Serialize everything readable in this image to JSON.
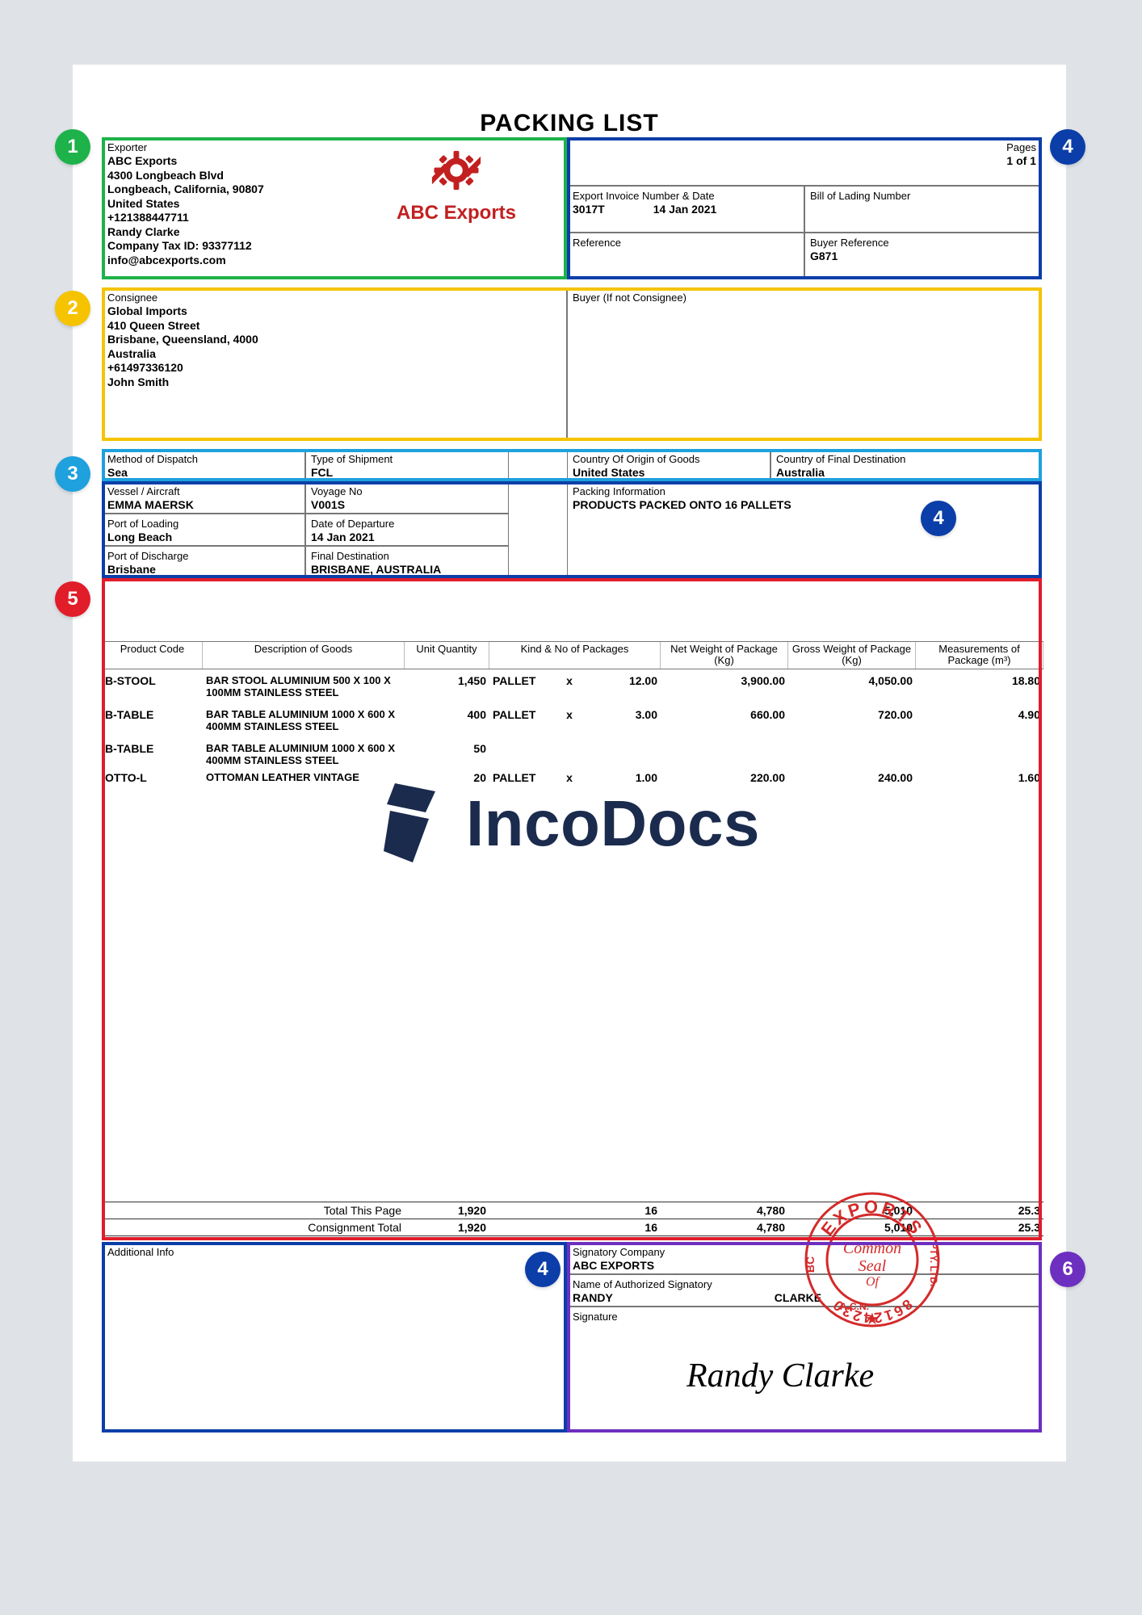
{
  "title": "PACKING LIST",
  "pages": {
    "label": "Pages",
    "value": "1 of 1"
  },
  "exporter": {
    "label": "Exporter",
    "name": "ABC Exports",
    "address1": "4300 Longbeach Blvd",
    "address2": "Longbeach, California, 90807",
    "country": "United States",
    "phone": "+121388447711",
    "contact": "Randy Clarke",
    "taxid": "Company Tax ID: 93377112",
    "email": "info@abcexports.com"
  },
  "logo_name": "ABC Exports",
  "invoice": {
    "label": "Export Invoice Number & Date",
    "number": "3017T",
    "date": "14 Jan 2021"
  },
  "bol": {
    "label": "Bill of Lading Number",
    "value": ""
  },
  "reference": {
    "label": "Reference",
    "value": ""
  },
  "buyer_ref": {
    "label": "Buyer Reference",
    "value": "G871"
  },
  "consignee": {
    "label": "Consignee",
    "name": "Global Imports",
    "address1": "410 Queen Street",
    "address2": "Brisbane, Queensland, 4000",
    "country": "Australia",
    "phone": "+61497336120",
    "contact": "John Smith"
  },
  "buyer_if_not": {
    "label": "Buyer (If not Consignee)",
    "value": ""
  },
  "dispatch": {
    "method": {
      "label": "Method of Dispatch",
      "value": "Sea"
    },
    "shipment_type": {
      "label": "Type of Shipment",
      "value": "FCL"
    },
    "origin": {
      "label": "Country Of Origin of Goods",
      "value": "United States"
    },
    "dest_country": {
      "label": "Country of Final Destination",
      "value": "Australia"
    },
    "vessel": {
      "label": "Vessel / Aircraft",
      "value": "EMMA MAERSK"
    },
    "voyage": {
      "label": "Voyage No",
      "value": "V001S"
    },
    "packing_info": {
      "label": "Packing Information",
      "value": "PRODUCTS PACKED ONTO 16 PALLETS"
    },
    "port_loading": {
      "label": "Port of Loading",
      "value": "Long Beach"
    },
    "dep_date": {
      "label": "Date of Departure",
      "value": "14 Jan 2021"
    },
    "port_discharge": {
      "label": "Port of Discharge",
      "value": "Brisbane"
    },
    "final_dest": {
      "label": "Final Destination",
      "value": "BRISBANE, AUSTRALIA"
    }
  },
  "table": {
    "headers": {
      "code": "Product Code",
      "desc": "Description of Goods",
      "qty": "Unit Quantity",
      "kind_head": "Kind & No of Packages",
      "net": "Net Weight of Package (Kg)",
      "gross": "Gross Weight of Package (Kg)",
      "meas": "Measurements of Package (m³)"
    },
    "rows": [
      {
        "code": "B-STOOL",
        "desc": "BAR STOOL ALUMINIUM 500 X 100 X 100MM STAINLESS STEEL",
        "qty": "1,450",
        "kind": "PALLET",
        "x": "x",
        "pkgs": "12.00",
        "net": "3,900.00",
        "gross": "4,050.00",
        "meas": "18.80"
      },
      {
        "code": "B-TABLE",
        "desc": "BAR TABLE ALUMINIUM 1000 X 600 X 400MM STAINLESS STEEL",
        "qty": "400",
        "kind": "PALLET",
        "x": "x",
        "pkgs": "3.00",
        "net": "660.00",
        "gross": "720.00",
        "meas": "4.90"
      },
      {
        "code": "B-TABLE",
        "desc": "BAR TABLE ALUMINIUM 1000 X 600 X 400MM STAINLESS STEEL",
        "qty": "50",
        "kind": "",
        "x": "",
        "pkgs": "",
        "net": "",
        "gross": "",
        "meas": ""
      },
      {
        "code": "OTTO-L",
        "desc": "OTTOMAN LEATHER VINTAGE",
        "qty": "20",
        "kind": "PALLET",
        "x": "x",
        "pkgs": "1.00",
        "net": "220.00",
        "gross": "240.00",
        "meas": "1.60"
      }
    ]
  },
  "totals": {
    "this_page": {
      "label": "Total This Page",
      "qty": "1,920",
      "pkgs": "16",
      "net": "4,780",
      "gross": "5,010",
      "meas": "25.3"
    },
    "consignment": {
      "label": "Consignment Total",
      "qty": "1,920",
      "pkgs": "16",
      "net": "4,780",
      "gross": "5,010",
      "meas": "25.3"
    }
  },
  "additional_info_label": "Additional Info",
  "signatory": {
    "company": {
      "label": "Signatory Company",
      "value": "ABC EXPORTS"
    },
    "auth": {
      "label": "Name of Authorized Signatory",
      "first": "RANDY",
      "last": "CLARKE"
    },
    "signature_label": "Signature",
    "signature_image": "Randy Clarke"
  },
  "stamp": {
    "line1": "EXPORTS",
    "line2": "Common",
    "line3": "Seal",
    "number": "86124230",
    "side_left": "BC",
    "side_right": "PTY. LTD.",
    "bottom": "A.C.N."
  },
  "watermark": "IncoDocs",
  "badges": {
    "b1": "1",
    "b2": "2",
    "b3": "3",
    "b4": "4",
    "b5": "5",
    "b6": "6"
  }
}
